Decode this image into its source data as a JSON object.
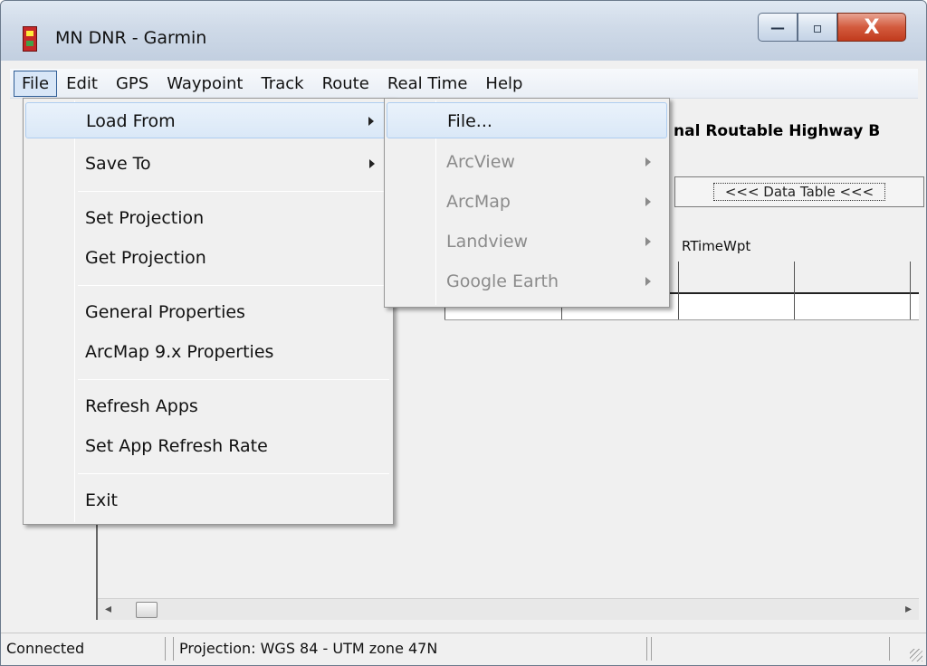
{
  "window": {
    "title": "MN DNR - Garmin",
    "caption": {
      "minimize": "—",
      "maximize": "▫",
      "close": "X"
    }
  },
  "menubar": {
    "items": [
      "File",
      "Edit",
      "GPS",
      "Waypoint",
      "Track",
      "Route",
      "Real Time",
      "Help"
    ]
  },
  "file_menu": {
    "items": [
      "Load From",
      "Save To",
      "Set Projection",
      "Get Projection",
      "General Properties",
      "ArcMap 9.x Properties",
      "Refresh Apps",
      "Set App Refresh Rate",
      "Exit"
    ]
  },
  "load_from_menu": {
    "items": [
      "File...",
      "ArcView",
      "ArcMap",
      "Landview",
      "Google Earth"
    ]
  },
  "content": {
    "title_fragment": "nal Routable Highway B",
    "data_table_button": "<<< Data Table <<<",
    "grid_label": "RTimeWpt"
  },
  "statusbar": {
    "connection": "Connected",
    "projection": "Projection: WGS 84 - UTM zone 47N"
  },
  "scroll": {
    "left": "◂",
    "right": "▸"
  }
}
